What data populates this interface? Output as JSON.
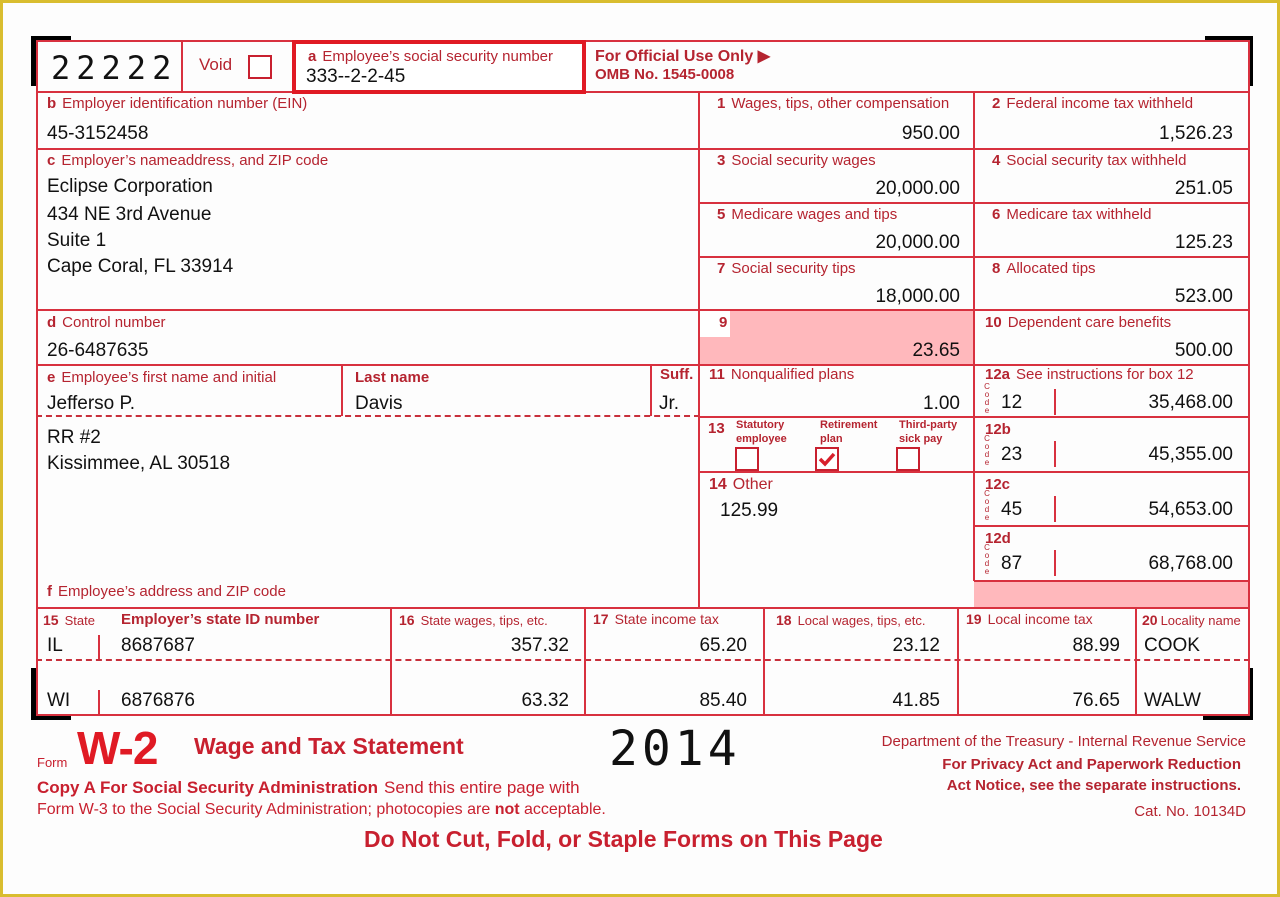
{
  "form": {
    "code": "22222",
    "void_label": "Void",
    "void_checked": false,
    "official_use": "For Official Use Only ▶",
    "omb": "OMB No. 1545-0008"
  },
  "box_a": {
    "letter": "a",
    "label": "Employee’s social security number",
    "value": "333--2-2-45"
  },
  "box_b": {
    "letter": "b",
    "label": "Employer identification number (EIN)",
    "value": "45-3152458"
  },
  "box_c": {
    "letter": "c",
    "label": "Employer’s nameaddress, and ZIP code",
    "lines": [
      "Eclipse Corporation",
      "434 NE 3rd Avenue",
      "Suite 1",
      "Cape Coral, FL 33914"
    ]
  },
  "box_d": {
    "letter": "d",
    "label": "Control number",
    "value": "26-6487635"
  },
  "box_e": {
    "letter": "e",
    "first_label": "Employee’s first name and initial",
    "first_value": "Jefferso P.",
    "last_label": "Last name",
    "last_value": "Davis",
    "suff_label": "Suff.",
    "suff_value": "Jr."
  },
  "box_f": {
    "letter": "f",
    "label": "Employee’s address and ZIP code",
    "lines": [
      "RR #2",
      "Kissimmee, AL 30518"
    ]
  },
  "boxes": {
    "b1": {
      "num": "1",
      "label": "Wages, tips, other compensation",
      "value": "950.00"
    },
    "b2": {
      "num": "2",
      "label": "Federal income tax withheld",
      "value": "1,526.23"
    },
    "b3": {
      "num": "3",
      "label": "Social security wages",
      "value": "20,000.00"
    },
    "b4": {
      "num": "4",
      "label": "Social security tax withheld",
      "value": "251.05"
    },
    "b5": {
      "num": "5",
      "label": "Medicare wages and tips",
      "value": "20,000.00"
    },
    "b6": {
      "num": "6",
      "label": "Medicare tax withheld",
      "value": "125.23"
    },
    "b7": {
      "num": "7",
      "label": "Social security tips",
      "value": "18,000.00"
    },
    "b8": {
      "num": "8",
      "label": "Allocated tips",
      "value": "523.00"
    },
    "b9": {
      "num": "9",
      "label": "",
      "value": "23.65"
    },
    "b10": {
      "num": "10",
      "label": "Dependent care benefits",
      "value": "500.00"
    },
    "b11": {
      "num": "11",
      "label": "Nonqualified plans",
      "value": "1.00"
    },
    "b13": {
      "num": "13",
      "statutory_label": "Statutory employee",
      "statutory_checked": false,
      "retirement_label": "Retirement plan",
      "retirement_checked": true,
      "thirdparty_label": "Third-party sick pay",
      "thirdparty_checked": false
    },
    "b14": {
      "num": "14",
      "label": "Other",
      "value": "125.99"
    }
  },
  "box12": {
    "code_glyph": "Code",
    "instructions": "See instructions for box 12",
    "rows": [
      {
        "id": "12a",
        "code": "12",
        "amount": "35,468.00"
      },
      {
        "id": "12b",
        "code": "23",
        "amount": "45,355.00"
      },
      {
        "id": "12c",
        "code": "45",
        "amount": "54,653.00"
      },
      {
        "id": "12d",
        "code": "87",
        "amount": "68,768.00"
      }
    ]
  },
  "state_section": {
    "headers": {
      "h15": {
        "num": "15",
        "label": "State"
      },
      "h15b": "Employer’s state ID number",
      "h16": {
        "num": "16",
        "label": "State wages, tips, etc."
      },
      "h17": {
        "num": "17",
        "label": "State income tax"
      },
      "h18": {
        "num": "18",
        "label": "Local wages, tips, etc."
      },
      "h19": {
        "num": "19",
        "label": "Local income tax"
      },
      "h20": {
        "num": "20",
        "label": "Locality name"
      }
    },
    "rows": [
      {
        "state": "IL",
        "state_id": "8687687",
        "state_wages": "357.32",
        "state_tax": "65.20",
        "local_wages": "23.12",
        "local_tax": "88.99",
        "locality": "COOK"
      },
      {
        "state": "WI",
        "state_id": "6876876",
        "state_wages": "63.32",
        "state_tax": "85.40",
        "local_wages": "41.85",
        "local_tax": "76.65",
        "locality": "WALW"
      }
    ]
  },
  "footer": {
    "form_word": "Form",
    "form_name": "W-2",
    "title": "Wage and Tax Statement",
    "year": "2014",
    "copy_bold": "Copy A For Social Security Administration",
    "copy_rest": "Send this entire page with",
    "line2_a": "Form W-3 to the Social Security Administration; photocopies are ",
    "line2_bold": "not",
    "line2_b": " acceptable.",
    "dept": "Department of the Treasury - Internal Revenue Service",
    "privacy1": "For Privacy Act and Paperwork Reduction",
    "privacy2": "Act Notice, see the separate instructions.",
    "cat": "Cat. No. 10134D",
    "warning": "Do Not Cut, Fold, or Staple Forms on This Page"
  }
}
